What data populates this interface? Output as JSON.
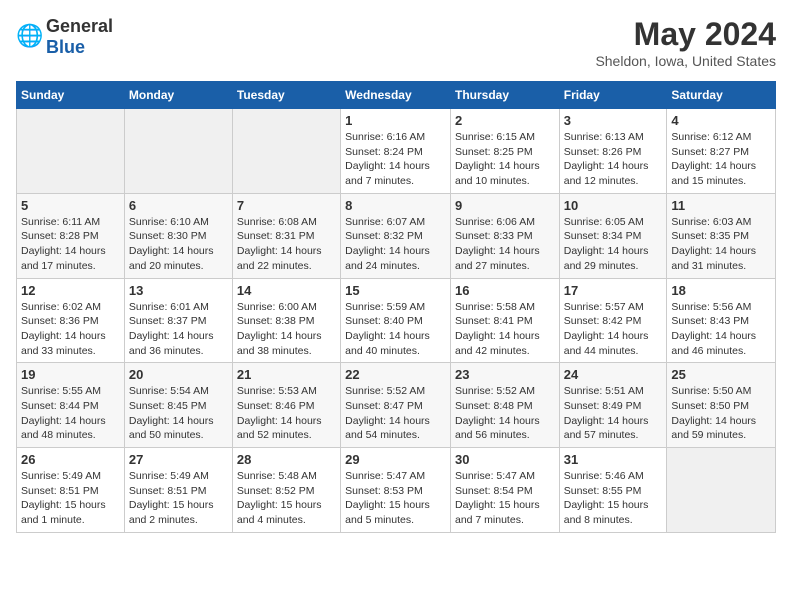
{
  "header": {
    "logo_general": "General",
    "logo_blue": "Blue",
    "month_year": "May 2024",
    "location": "Sheldon, Iowa, United States"
  },
  "days_of_week": [
    "Sunday",
    "Monday",
    "Tuesday",
    "Wednesday",
    "Thursday",
    "Friday",
    "Saturday"
  ],
  "weeks": [
    [
      {
        "day": "",
        "info": ""
      },
      {
        "day": "",
        "info": ""
      },
      {
        "day": "",
        "info": ""
      },
      {
        "day": "1",
        "info": "Sunrise: 6:16 AM\nSunset: 8:24 PM\nDaylight: 14 hours\nand 7 minutes."
      },
      {
        "day": "2",
        "info": "Sunrise: 6:15 AM\nSunset: 8:25 PM\nDaylight: 14 hours\nand 10 minutes."
      },
      {
        "day": "3",
        "info": "Sunrise: 6:13 AM\nSunset: 8:26 PM\nDaylight: 14 hours\nand 12 minutes."
      },
      {
        "day": "4",
        "info": "Sunrise: 6:12 AM\nSunset: 8:27 PM\nDaylight: 14 hours\nand 15 minutes."
      }
    ],
    [
      {
        "day": "5",
        "info": "Sunrise: 6:11 AM\nSunset: 8:28 PM\nDaylight: 14 hours\nand 17 minutes."
      },
      {
        "day": "6",
        "info": "Sunrise: 6:10 AM\nSunset: 8:30 PM\nDaylight: 14 hours\nand 20 minutes."
      },
      {
        "day": "7",
        "info": "Sunrise: 6:08 AM\nSunset: 8:31 PM\nDaylight: 14 hours\nand 22 minutes."
      },
      {
        "day": "8",
        "info": "Sunrise: 6:07 AM\nSunset: 8:32 PM\nDaylight: 14 hours\nand 24 minutes."
      },
      {
        "day": "9",
        "info": "Sunrise: 6:06 AM\nSunset: 8:33 PM\nDaylight: 14 hours\nand 27 minutes."
      },
      {
        "day": "10",
        "info": "Sunrise: 6:05 AM\nSunset: 8:34 PM\nDaylight: 14 hours\nand 29 minutes."
      },
      {
        "day": "11",
        "info": "Sunrise: 6:03 AM\nSunset: 8:35 PM\nDaylight: 14 hours\nand 31 minutes."
      }
    ],
    [
      {
        "day": "12",
        "info": "Sunrise: 6:02 AM\nSunset: 8:36 PM\nDaylight: 14 hours\nand 33 minutes."
      },
      {
        "day": "13",
        "info": "Sunrise: 6:01 AM\nSunset: 8:37 PM\nDaylight: 14 hours\nand 36 minutes."
      },
      {
        "day": "14",
        "info": "Sunrise: 6:00 AM\nSunset: 8:38 PM\nDaylight: 14 hours\nand 38 minutes."
      },
      {
        "day": "15",
        "info": "Sunrise: 5:59 AM\nSunset: 8:40 PM\nDaylight: 14 hours\nand 40 minutes."
      },
      {
        "day": "16",
        "info": "Sunrise: 5:58 AM\nSunset: 8:41 PM\nDaylight: 14 hours\nand 42 minutes."
      },
      {
        "day": "17",
        "info": "Sunrise: 5:57 AM\nSunset: 8:42 PM\nDaylight: 14 hours\nand 44 minutes."
      },
      {
        "day": "18",
        "info": "Sunrise: 5:56 AM\nSunset: 8:43 PM\nDaylight: 14 hours\nand 46 minutes."
      }
    ],
    [
      {
        "day": "19",
        "info": "Sunrise: 5:55 AM\nSunset: 8:44 PM\nDaylight: 14 hours\nand 48 minutes."
      },
      {
        "day": "20",
        "info": "Sunrise: 5:54 AM\nSunset: 8:45 PM\nDaylight: 14 hours\nand 50 minutes."
      },
      {
        "day": "21",
        "info": "Sunrise: 5:53 AM\nSunset: 8:46 PM\nDaylight: 14 hours\nand 52 minutes."
      },
      {
        "day": "22",
        "info": "Sunrise: 5:52 AM\nSunset: 8:47 PM\nDaylight: 14 hours\nand 54 minutes."
      },
      {
        "day": "23",
        "info": "Sunrise: 5:52 AM\nSunset: 8:48 PM\nDaylight: 14 hours\nand 56 minutes."
      },
      {
        "day": "24",
        "info": "Sunrise: 5:51 AM\nSunset: 8:49 PM\nDaylight: 14 hours\nand 57 minutes."
      },
      {
        "day": "25",
        "info": "Sunrise: 5:50 AM\nSunset: 8:50 PM\nDaylight: 14 hours\nand 59 minutes."
      }
    ],
    [
      {
        "day": "26",
        "info": "Sunrise: 5:49 AM\nSunset: 8:51 PM\nDaylight: 15 hours\nand 1 minute."
      },
      {
        "day": "27",
        "info": "Sunrise: 5:49 AM\nSunset: 8:51 PM\nDaylight: 15 hours\nand 2 minutes."
      },
      {
        "day": "28",
        "info": "Sunrise: 5:48 AM\nSunset: 8:52 PM\nDaylight: 15 hours\nand 4 minutes."
      },
      {
        "day": "29",
        "info": "Sunrise: 5:47 AM\nSunset: 8:53 PM\nDaylight: 15 hours\nand 5 minutes."
      },
      {
        "day": "30",
        "info": "Sunrise: 5:47 AM\nSunset: 8:54 PM\nDaylight: 15 hours\nand 7 minutes."
      },
      {
        "day": "31",
        "info": "Sunrise: 5:46 AM\nSunset: 8:55 PM\nDaylight: 15 hours\nand 8 minutes."
      },
      {
        "day": "",
        "info": ""
      }
    ]
  ]
}
